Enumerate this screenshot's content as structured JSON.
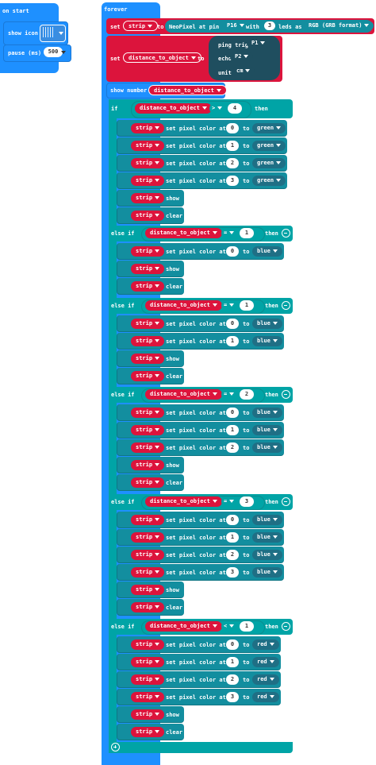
{
  "on_start": {
    "title": "on start",
    "show_icon_label": "show icon",
    "pause_label": "pause (ms)",
    "pause_value": "500"
  },
  "forever": {
    "title": "forever",
    "set_strip": {
      "set_label": "set",
      "var": "strip",
      "to_label": "to",
      "neopixel_label": "NeoPixel at pin",
      "pin": "P16",
      "with_label": "with",
      "leds": "3",
      "leds_as_label": "leds as",
      "format": "RGB (GRB format)"
    },
    "set_distance": {
      "set_label": "set",
      "var": "distance_to_object",
      "to_label": "to",
      "ping_trig_label": "ping trig",
      "trig_pin": "P1",
      "echo_label": "echo",
      "echo_pin": "P2",
      "unit_label": "unit",
      "unit": "cm"
    },
    "show_number": {
      "label": "show number",
      "var": "distance_to_object"
    }
  },
  "conditional": {
    "if_label": "if",
    "else_if_label": "else if",
    "then_label": "then",
    "branches": [
      {
        "op": ">",
        "value": "4",
        "leds": [
          {
            "i": "0",
            "c": "green"
          },
          {
            "i": "1",
            "c": "green"
          },
          {
            "i": "2",
            "c": "green"
          },
          {
            "i": "3",
            "c": "green"
          }
        ]
      },
      {
        "op": "=",
        "value": "1",
        "leds": [
          {
            "i": "0",
            "c": "blue"
          }
        ]
      },
      {
        "op": "=",
        "value": "1",
        "leds": [
          {
            "i": "0",
            "c": "blue"
          },
          {
            "i": "1",
            "c": "blue"
          }
        ]
      },
      {
        "op": "=",
        "value": "2",
        "leds": [
          {
            "i": "0",
            "c": "blue"
          },
          {
            "i": "1",
            "c": "blue"
          },
          {
            "i": "2",
            "c": "blue"
          }
        ]
      },
      {
        "op": "=",
        "value": "3",
        "leds": [
          {
            "i": "0",
            "c": "blue"
          },
          {
            "i": "1",
            "c": "blue"
          },
          {
            "i": "2",
            "c": "blue"
          },
          {
            "i": "3",
            "c": "blue"
          }
        ]
      },
      {
        "op": "<",
        "value": "1",
        "leds": [
          {
            "i": "0",
            "c": "red"
          },
          {
            "i": "1",
            "c": "red"
          },
          {
            "i": "2",
            "c": "red"
          },
          {
            "i": "3",
            "c": "red"
          }
        ]
      }
    ],
    "strip_var": "strip",
    "set_pixel_label": "set pixel color at",
    "to_label": "to",
    "show_label": "show",
    "clear_label": "clear",
    "compare_var": "distance_to_object"
  },
  "colors": {
    "basic_blue": "#1e90ff",
    "variable_red": "#dc143c",
    "logic_teal": "#00a4a6",
    "neopixel_teal": "#138e9f"
  }
}
